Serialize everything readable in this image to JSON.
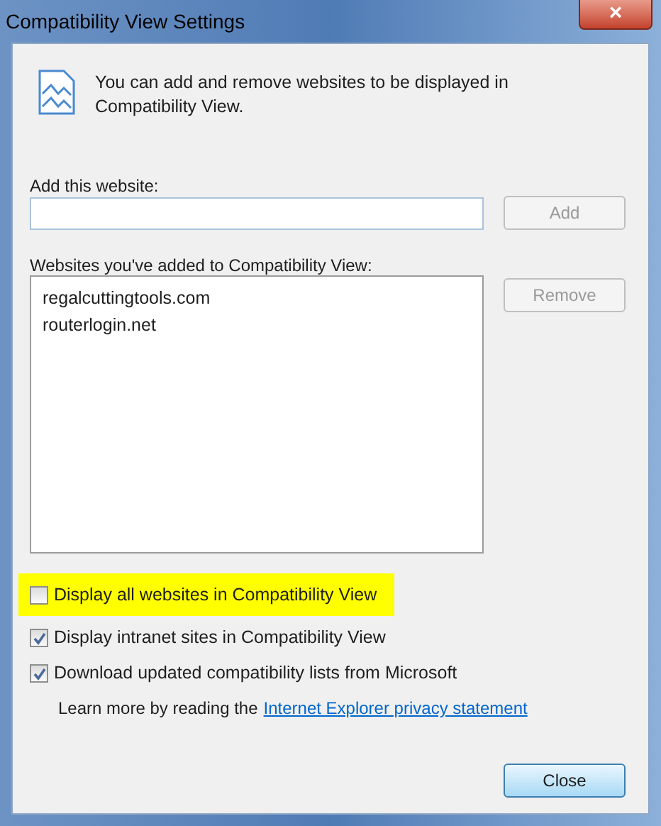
{
  "window": {
    "title": "Compatibility View Settings",
    "close_label": "×"
  },
  "intro": "You can add and remove websites to be displayed in Compatibility View.",
  "add_field": {
    "label": "Add this website:"
  },
  "add_button": {
    "label": "Add",
    "disabled": true
  },
  "list": {
    "label": "Websites you've added to Compatibility View:",
    "items": [
      "regalcuttingtools.com",
      "routerlogin.net"
    ]
  },
  "remove_button": {
    "label": "Remove",
    "disabled": true
  },
  "options": [
    {
      "label": "Display all websites in Compatibility View",
      "checked": false,
      "highlighted": true
    },
    {
      "label": "Display intranet sites in Compatibility View",
      "checked": true,
      "highlighted": false
    },
    {
      "label": "Download updated compatibility lists from Microsoft",
      "checked": true,
      "highlighted": false
    }
  ],
  "learn_more": {
    "text": "Learn more by reading the",
    "link": "Internet Explorer privacy statement"
  },
  "close_button": {
    "label": "Close"
  }
}
